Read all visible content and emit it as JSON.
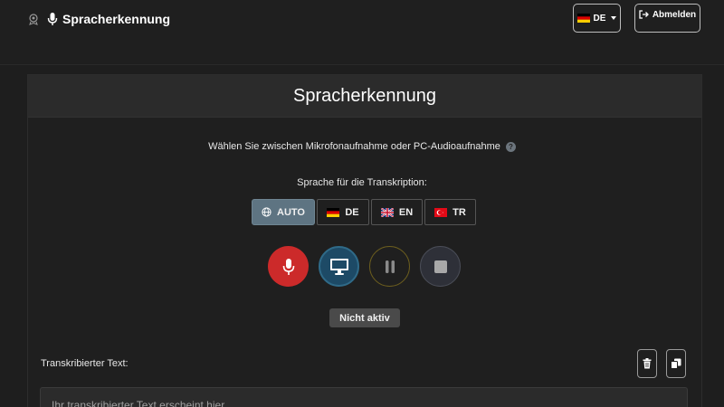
{
  "navbar": {
    "brand_title": "Spracherkennung",
    "logo_icon": "seal-logo-icon",
    "mic_icon": "microphone-icon",
    "language_selector": {
      "selected": "DE",
      "flag": "flag-de-icon"
    },
    "logout": {
      "label": "Abmelden",
      "icon": "logout-icon"
    }
  },
  "card": {
    "title": "Spracherkennung",
    "subtitle": "Wählen Sie zwischen Mikrofonaufnahme oder PC-Audioaufnahme",
    "help_icon": "question-circle-icon",
    "language_label": "Sprache für die Transkription:",
    "languages": [
      {
        "code": "AUTO",
        "label": "AUTO",
        "icon": "globe-icon",
        "active": true
      },
      {
        "code": "DE",
        "label": "DE",
        "icon": "flag-de-icon",
        "active": false
      },
      {
        "code": "EN",
        "label": "EN",
        "icon": "flag-uk-icon",
        "active": false
      },
      {
        "code": "TR",
        "label": "TR",
        "icon": "flag-tr-icon",
        "active": false
      }
    ],
    "controls": [
      {
        "name": "record-mic-button",
        "icon": "microphone-icon",
        "color": "#cc2a2a"
      },
      {
        "name": "record-pc-audio-button",
        "icon": "monitor-icon",
        "color": "#1d4a66"
      },
      {
        "name": "pause-button",
        "icon": "pause-icon",
        "color": "#6b5d1e"
      },
      {
        "name": "stop-button",
        "icon": "stop-icon",
        "color": "#2e3038"
      }
    ],
    "status": "Nicht aktiv",
    "transcript_label": "Transkribierter Text:",
    "clear_icon": "trash-icon",
    "copy_icon": "copy-icon",
    "transcript_placeholder": "Ihr transkribierter Text erscheint hier..."
  },
  "colors": {
    "background": "#1e1e1e",
    "card_header": "#2b2b2b",
    "active_language": "#5e7482",
    "record": "#cc2a2a",
    "pc_audio": "#1d4a66",
    "status_bg": "#4a4a4a"
  }
}
